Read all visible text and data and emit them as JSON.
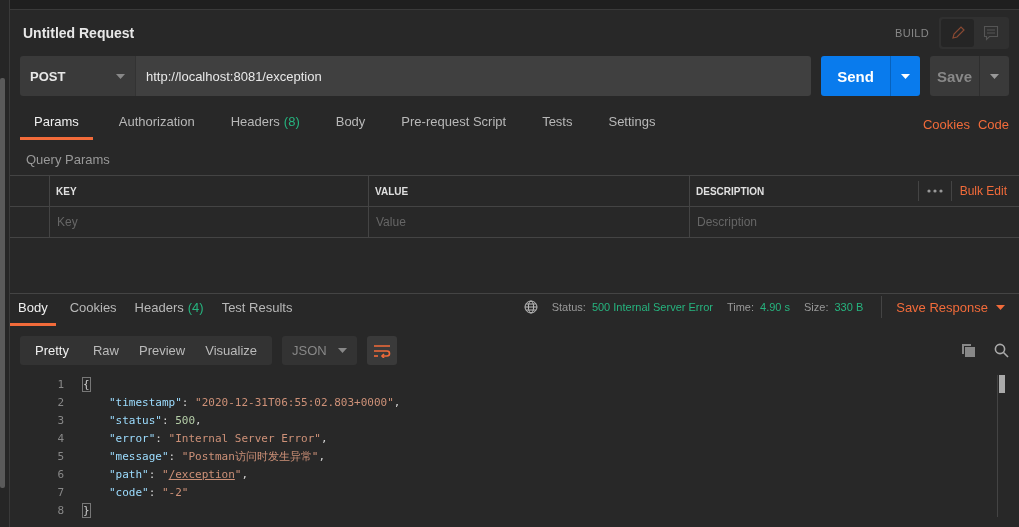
{
  "request": {
    "title": "Untitled Request",
    "mode": "BUILD",
    "build_selected": true,
    "method": "POST",
    "url": "http://localhost:8081/exception",
    "send": "Send",
    "save": "Save"
  },
  "request_tabs": [
    {
      "label": "Params",
      "selected": true
    },
    {
      "label": "Authorization",
      "selected": false
    },
    {
      "label": "Headers",
      "count": "(8)",
      "selected": false
    },
    {
      "label": "Body",
      "selected": false
    },
    {
      "label": "Pre-request Script",
      "selected": false
    },
    {
      "label": "Tests",
      "selected": false
    },
    {
      "label": "Settings",
      "selected": false
    }
  ],
  "request_links": [
    "Cookies",
    "Code"
  ],
  "query_params": {
    "title": "Query Params",
    "columns": [
      "KEY",
      "VALUE",
      "DESCRIPTION"
    ],
    "bulk_edit": "Bulk Edit",
    "placeholders": [
      "Key",
      "Value",
      "Description"
    ]
  },
  "response_tabs": [
    {
      "label": "Body",
      "selected": true
    },
    {
      "label": "Cookies",
      "selected": false
    },
    {
      "label": "Headers",
      "count": "(4)",
      "selected": false
    },
    {
      "label": "Test Results",
      "selected": false
    }
  ],
  "response_status": [
    {
      "label": "Status:",
      "value": "500 Internal Server Error"
    },
    {
      "label": "Time:",
      "value": "4.90 s"
    },
    {
      "label": "Size:",
      "value": "330 B"
    }
  ],
  "save_response": "Save Response",
  "view_modes": [
    {
      "label": "Pretty",
      "selected": true
    },
    {
      "label": "Raw",
      "selected": false
    },
    {
      "label": "Preview",
      "selected": false
    },
    {
      "label": "Visualize",
      "selected": false
    }
  ],
  "format": "JSON",
  "wrap_on": true,
  "code_lines": [
    {
      "number": "1",
      "tokens": [
        {
          "kind": "brace",
          "text": "{"
        }
      ]
    },
    {
      "number": "2",
      "tokens": [
        {
          "kind": "key",
          "text": "\"timestamp\""
        },
        {
          "kind": "punct",
          "text": ": "
        },
        {
          "kind": "string",
          "text": "\"2020-12-31T06:55:02.803+0000\""
        },
        {
          "kind": "punct",
          "text": ","
        }
      ]
    },
    {
      "number": "3",
      "tokens": [
        {
          "kind": "key",
          "text": "\"status\""
        },
        {
          "kind": "punct",
          "text": ": "
        },
        {
          "kind": "number",
          "text": "500"
        },
        {
          "kind": "punct",
          "text": ","
        }
      ]
    },
    {
      "number": "4",
      "tokens": [
        {
          "kind": "key",
          "text": "\"error\""
        },
        {
          "kind": "punct",
          "text": ": "
        },
        {
          "kind": "string",
          "text": "\"Internal Server Error\""
        },
        {
          "kind": "punct",
          "text": ","
        }
      ]
    },
    {
      "number": "5",
      "tokens": [
        {
          "kind": "key",
          "text": "\"message\""
        },
        {
          "kind": "punct",
          "text": ": "
        },
        {
          "kind": "string",
          "text": "\"Postman访问时发生异常\""
        },
        {
          "kind": "punct",
          "text": ","
        }
      ]
    },
    {
      "number": "6",
      "tokens": [
        {
          "kind": "key",
          "text": "\"path\""
        },
        {
          "kind": "punct",
          "text": ": "
        },
        {
          "kind": "string",
          "text": "\""
        },
        {
          "kind": "link",
          "text": "/exception"
        },
        {
          "kind": "string",
          "text": "\""
        },
        {
          "kind": "punct",
          "text": ","
        }
      ]
    },
    {
      "number": "7",
      "tokens": [
        {
          "kind": "key",
          "text": "\"code\""
        },
        {
          "kind": "punct",
          "text": ": "
        },
        {
          "kind": "string",
          "text": "\"-2\""
        }
      ]
    },
    {
      "number": "8",
      "tokens": [
        {
          "kind": "brace",
          "text": "}"
        }
      ]
    }
  ]
}
